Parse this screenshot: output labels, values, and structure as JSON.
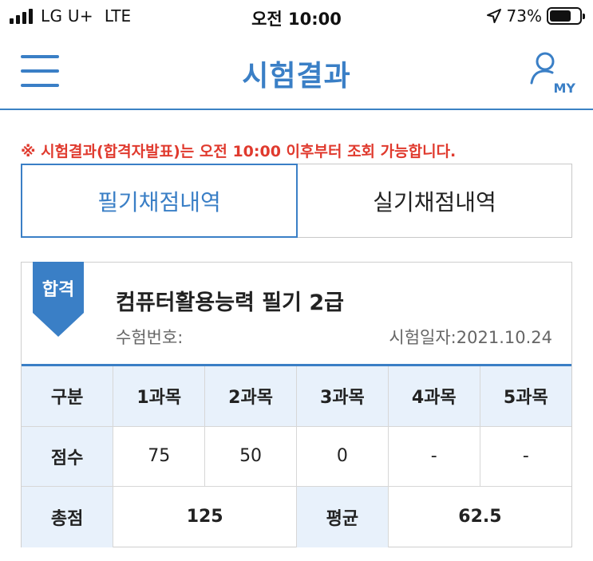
{
  "status_bar": {
    "carrier": "LG U+",
    "network": "LTE",
    "time": "오전 10:00",
    "battery": "73%"
  },
  "header": {
    "title": "시험결과",
    "my_label": "MY",
    "icons": [
      "menu-icon",
      "user-icon"
    ]
  },
  "notice": "※ 시험결과(합격자발표)는 오전 10:00 이후부터 조회 가능합니다.",
  "tabs": [
    {
      "label": "필기채점내역",
      "active": true
    },
    {
      "label": "실기채점내역",
      "active": false
    }
  ],
  "result": {
    "status": "합격",
    "exam_name": "컴퓨터활용능력 필기 2급",
    "exam_no_label": "수험번호:",
    "exam_date": "시험일자:2021.10.24",
    "table": {
      "header": [
        "구분",
        "1과목",
        "2과목",
        "3과목",
        "4과목",
        "5과목"
      ],
      "score_row": [
        "점수",
        "75",
        "50",
        "0",
        "-",
        "-"
      ],
      "total_label": "총점",
      "total_value": "125",
      "average_label": "평균",
      "average_value": "62.5"
    }
  },
  "colors": {
    "accent": "#3a7fc6",
    "notice": "#e03a2e",
    "table_header_bg": "#e8f1fb"
  }
}
